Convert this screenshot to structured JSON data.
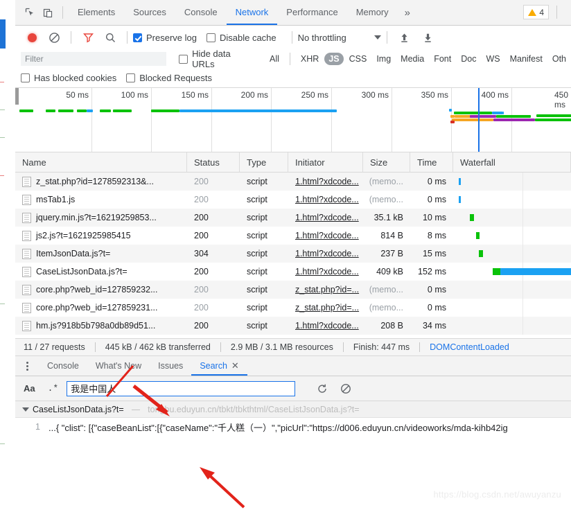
{
  "panel_tabs": [
    {
      "label": "Elements",
      "active": false
    },
    {
      "label": "Sources",
      "active": false
    },
    {
      "label": "Console",
      "active": false
    },
    {
      "label": "Network",
      "active": true
    },
    {
      "label": "Performance",
      "active": false
    },
    {
      "label": "Memory",
      "active": false
    }
  ],
  "more_tabs_glyph": "»",
  "warnings": {
    "count": "4",
    "icon": "warning-triangle-icon"
  },
  "toolbar": {
    "record_icon": "record-dot-icon",
    "clear_icon": "clear-circle-slash-icon",
    "filter_icon": "filter-funnel-icon",
    "search_icon": "search-magnifier-icon",
    "preserve_log": {
      "label": "Preserve log",
      "checked": true
    },
    "disable_cache": {
      "label": "Disable cache",
      "checked": false
    },
    "throttling": {
      "value": "No throttling",
      "caret": "chevron-down-icon"
    },
    "import_icon": "upload-arrow-icon",
    "export_icon": "download-arrow-icon"
  },
  "filters": {
    "input_placeholder": "Filter",
    "input_value": "",
    "hide_data_urls": {
      "label": "Hide data URLs",
      "checked": false
    },
    "types": [
      {
        "label": "All",
        "active": false
      },
      {
        "label": "XHR",
        "active": false
      },
      {
        "label": "JS",
        "active": true
      },
      {
        "label": "CSS",
        "active": false
      },
      {
        "label": "Img",
        "active": false
      },
      {
        "label": "Media",
        "active": false
      },
      {
        "label": "Font",
        "active": false
      },
      {
        "label": "Doc",
        "active": false
      },
      {
        "label": "WS",
        "active": false
      },
      {
        "label": "Manifest",
        "active": false
      },
      {
        "label": "Oth",
        "active": false
      }
    ],
    "has_blocked_cookies": {
      "label": "Has blocked cookies",
      "checked": false
    },
    "blocked_requests": {
      "label": "Blocked Requests",
      "checked": false
    }
  },
  "overview": {
    "ticks": [
      "50 ms",
      "100 ms",
      "150 ms",
      "200 ms",
      "250 ms",
      "300 ms",
      "350 ms",
      "400 ms",
      "450 ms"
    ],
    "dom_content_loaded_color": "#1a73e8",
    "load_color": "#d93025"
  },
  "table": {
    "columns": [
      "Name",
      "Status",
      "Type",
      "Initiator",
      "Size",
      "Time",
      "Waterfall"
    ],
    "rows": [
      {
        "name": "z_stat.php?id=1278592313&...",
        "status": "200",
        "status_dim": true,
        "type": "script",
        "initiator": "1.html?xdcode...",
        "size": "(memo...",
        "size_dim": true,
        "time": "0 ms"
      },
      {
        "name": "msTab1.js",
        "status": "200",
        "status_dim": true,
        "type": "script",
        "initiator": "1.html?xdcode...",
        "size": "(memo...",
        "size_dim": true,
        "time": "0 ms"
      },
      {
        "name": "jquery.min.js?t=16219259853...",
        "status": "200",
        "status_dim": false,
        "type": "script",
        "initiator": "1.html?xdcode...",
        "size": "35.1 kB",
        "size_dim": false,
        "time": "10 ms"
      },
      {
        "name": "js2.js?t=1621925985415",
        "status": "200",
        "status_dim": false,
        "type": "script",
        "initiator": "1.html?xdcode...",
        "size": "814 B",
        "size_dim": false,
        "time": "8 ms"
      },
      {
        "name": "ItemJsonData.js?t=",
        "status": "304",
        "status_dim": false,
        "type": "script",
        "initiator": "1.html?xdcode...",
        "size": "237 B",
        "size_dim": false,
        "time": "15 ms"
      },
      {
        "name": "CaseListJsonData.js?t=",
        "status": "200",
        "status_dim": false,
        "type": "script",
        "initiator": "1.html?xdcode...",
        "size": "409 kB",
        "size_dim": false,
        "time": "152 ms"
      },
      {
        "name": "core.php?web_id=127859232...",
        "status": "200",
        "status_dim": true,
        "type": "script",
        "initiator": "z_stat.php?id=...",
        "size": "(memo...",
        "size_dim": true,
        "time": "0 ms"
      },
      {
        "name": "core.php?web_id=127859231...",
        "status": "200",
        "status_dim": true,
        "type": "script",
        "initiator": "z_stat.php?id=...",
        "size": "(memo...",
        "size_dim": true,
        "time": "0 ms"
      },
      {
        "name": "hm.js?918b5b798a0db89d51...",
        "status": "200",
        "status_dim": false,
        "type": "script",
        "initiator": "1.html?xdcode...",
        "size": "208 B",
        "size_dim": false,
        "time": "34 ms"
      }
    ]
  },
  "summary": {
    "requests": "11 / 27 requests",
    "transferred": "445 kB / 462 kB transferred",
    "resources": "2.9 MB / 3.1 MB resources",
    "finish": "Finish: 447 ms",
    "dom_content_loaded": "DOMContentLoaded"
  },
  "drawer": {
    "menu_icon": "kebab-menu-icon",
    "tabs": [
      {
        "label": "Console",
        "active": false,
        "closable": false
      },
      {
        "label": "What's New",
        "active": false,
        "closable": false
      },
      {
        "label": "Issues",
        "active": false,
        "closable": false
      },
      {
        "label": "Search",
        "active": true,
        "closable": true
      }
    ],
    "close_glyph": "✕"
  },
  "search": {
    "match_case_label": "Aa",
    "regex_label": ".*",
    "query": "我是中国人",
    "placeholder": "",
    "refresh_icon": "refresh-icon",
    "clear_icon": "clear-circle-slash-icon"
  },
  "results": {
    "group_title": "CaseListJsonData.js?t=",
    "group_dash": "—",
    "group_url": "tongbu.eduyun.cn/tbkt/tbkthtml/CaseListJsonData.js?t=",
    "line_number": "1",
    "line_text": "...{ \"clist\": [{\"caseBeanList\":[{\"caseName\":\"千人糕（一）\",\"picUrl\":\"https://d006.eduyun.cn/videoworks/mda-kihb42ig"
  },
  "watermark": "https://blog.csdn.net/awuyanzu",
  "colors": {
    "accent": "#1a73e8",
    "record": "#e8453c",
    "waterfall_green": "#0ac20a",
    "waterfall_blue": "#1ba1f2",
    "waterfall_orange": "#f5a623",
    "waterfall_purple": "#9c27b0",
    "load_red": "#d93025",
    "annotation_arrow": "#e2231a"
  }
}
